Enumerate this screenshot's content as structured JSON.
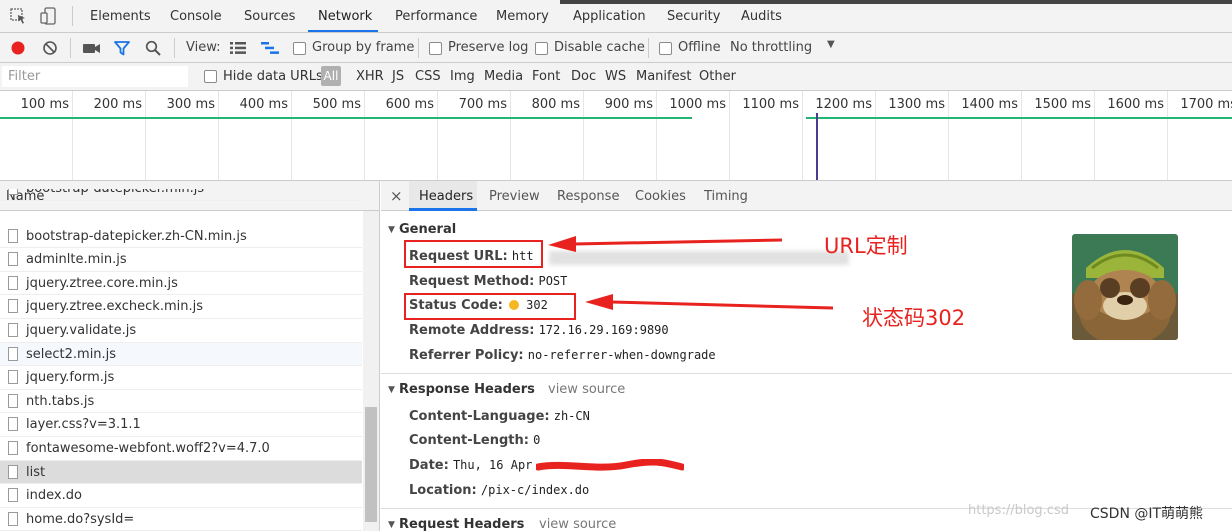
{
  "devtools": {
    "tabs": [
      "Elements",
      "Console",
      "Sources",
      "Network",
      "Performance",
      "Memory",
      "Application",
      "Security",
      "Audits"
    ],
    "active_tab": "Network"
  },
  "toolbar": {
    "view_label": "View:",
    "group_by_frame": "Group by frame",
    "preserve_log": "Preserve log",
    "disable_cache": "Disable cache",
    "offline": "Offline",
    "throttling": "No throttling"
  },
  "filter": {
    "placeholder": "Filter",
    "hide_data_urls": "Hide data URLs",
    "types": [
      "All",
      "XHR",
      "JS",
      "CSS",
      "Img",
      "Media",
      "Font",
      "Doc",
      "WS",
      "Manifest",
      "Other"
    ]
  },
  "timeline": {
    "ticks": [
      "100 ms",
      "200 ms",
      "300 ms",
      "400 ms",
      "500 ms",
      "600 ms",
      "700 ms",
      "800 ms",
      "900 ms",
      "1000 ms",
      "1100 ms",
      "1200 ms",
      "1300 ms",
      "1400 ms",
      "1500 ms",
      "1600 ms",
      "1700 ms"
    ]
  },
  "requests": {
    "header": "Name",
    "items": [
      "bootstrap-datepicker.min.js",
      "bootstrap-datepicker.zh-CN.min.js",
      "adminlte.min.js",
      "jquery.ztree.core.min.js",
      "jquery.ztree.excheck.min.js",
      "jquery.validate.js",
      "select2.min.js",
      "jquery.form.js",
      "nth.tabs.js",
      "layer.css?v=3.1.1",
      "fontawesome-webfont.woff2?v=4.7.0",
      "list",
      "index.do",
      "home.do?sysId="
    ],
    "selected_index": 11
  },
  "details": {
    "close": "×",
    "tabs": [
      "Headers",
      "Preview",
      "Response",
      "Cookies",
      "Timing"
    ],
    "active_tab": "Headers",
    "general": {
      "title": "General",
      "request_url_key": "Request URL:",
      "request_url_value": "htt",
      "request_method_key": "Request Method:",
      "request_method_value": "POST",
      "status_code_key": "Status Code:",
      "status_code_value": "302",
      "remote_address_key": "Remote Address:",
      "remote_address_value": "172.16.29.169:9890",
      "referrer_policy_key": "Referrer Policy:",
      "referrer_policy_value": "no-referrer-when-downgrade"
    },
    "response_headers": {
      "title": "Response Headers",
      "view_source": "view source",
      "content_language_key": "Content-Language:",
      "content_language_value": "zh-CN",
      "content_length_key": "Content-Length:",
      "content_length_value": "0",
      "date_key": "Date:",
      "date_value": "Thu, 16 Apr",
      "location_key": "Location:",
      "location_value": "/pix-c/index.do"
    },
    "request_headers": {
      "title": "Request Headers",
      "view_source": "view source"
    }
  },
  "annotations": {
    "url_label": "URL定制",
    "status_label": "状态码302",
    "color": "#e8231f"
  },
  "watermark": {
    "url": "https://blog.csd",
    "csdn": "CSDN @IT萌萌熊"
  },
  "colors": {
    "record": "#e8231f",
    "filter_active": "#1a73e8",
    "waterfall": "#22b573",
    "status_dot": "#f5b821"
  }
}
